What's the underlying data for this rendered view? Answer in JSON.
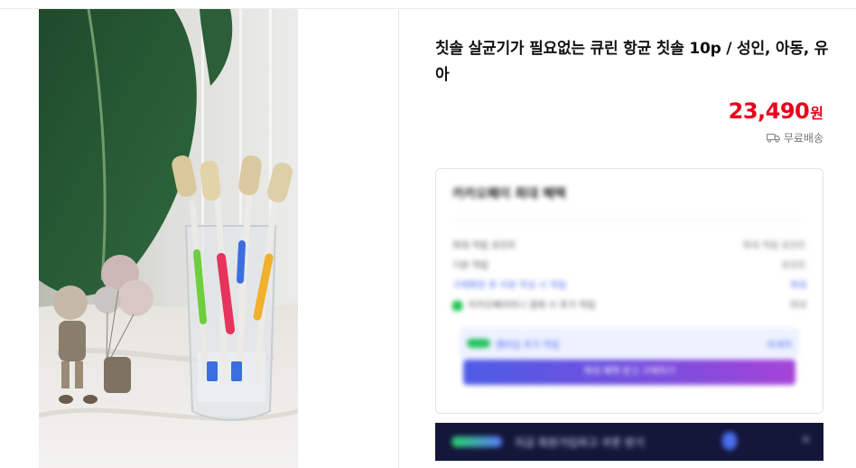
{
  "product": {
    "title": "칫솔 살균기가 필요없는 큐린 항균 칫솔 10p / 성인, 아동, 유아",
    "price_number": "23,490",
    "price_unit": "원",
    "shipping_label": "무료배송",
    "shipping_icon": "truck-icon"
  },
  "benefit_card": {
    "title": "카카오페이 최대 혜택",
    "rows": [
      {
        "label": "최대 적립 포인트",
        "value": "최대 적립 포인트"
      },
      {
        "label": "기본 적립",
        "value": "포인트"
      },
      {
        "label": "구매확정 후 리뷰 작성 시 적립",
        "value": "최대"
      },
      {
        "label": "카카오페이머니 결제 시 추가 적립",
        "value": "최대"
      }
    ],
    "hint_text": "멤버십 추가 적립",
    "hint_link": "자세히",
    "cta_label": "최대 혜택 받고 구매하기"
  },
  "banner": {
    "text": "지금 회원가입하고 쿠폰 받기",
    "close_icon": "close-icon"
  },
  "colors": {
    "price": "#e8001c",
    "banner_bg": "#14163a",
    "cta_start": "#4d5ce6",
    "cta_end": "#a644d8"
  }
}
